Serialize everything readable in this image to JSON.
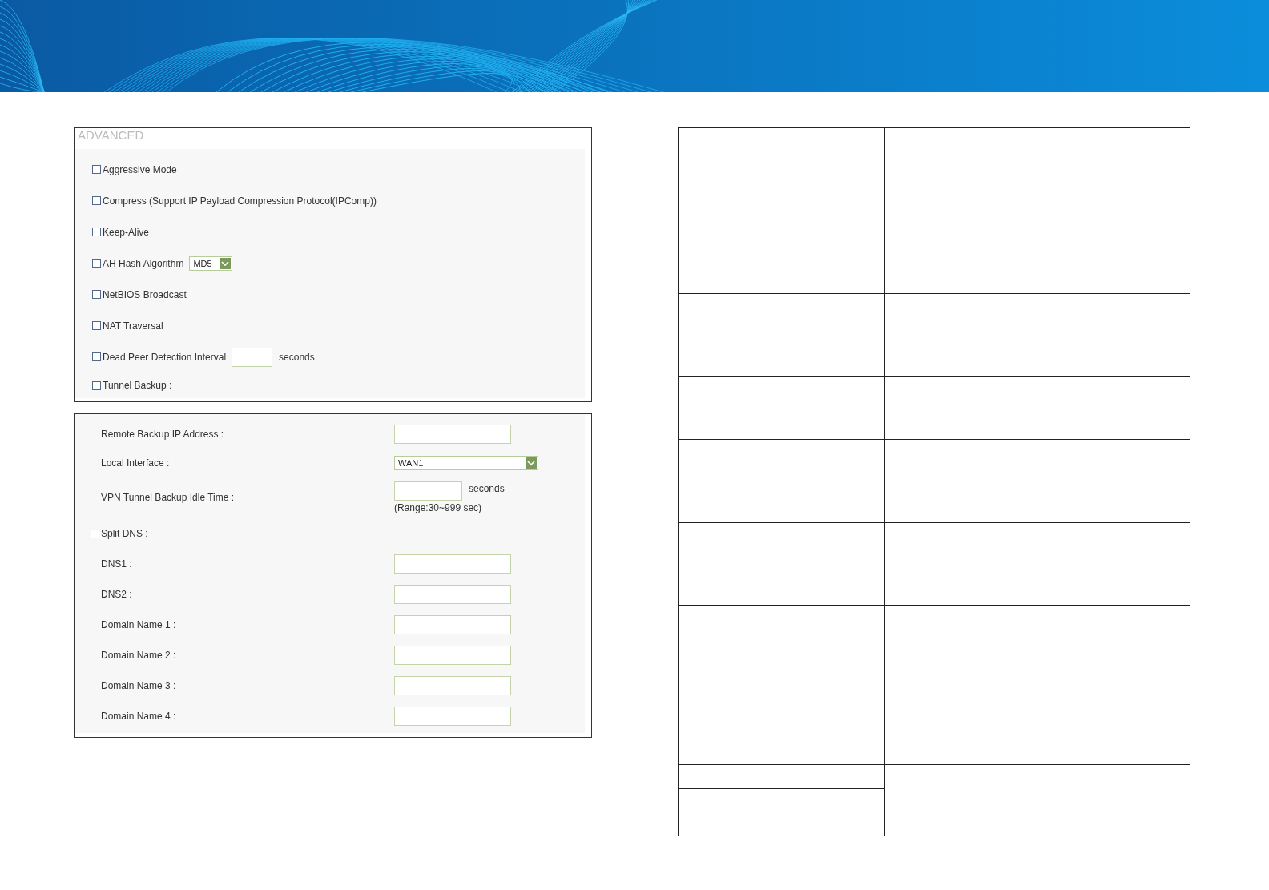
{
  "advanced": {
    "title": "ADVANCED",
    "options": [
      {
        "kind": "checkbox",
        "label": "Aggressive Mode",
        "checked": false
      },
      {
        "kind": "checkbox",
        "label": "Compress (Support IP Payload Compression Protocol(IPComp))",
        "checked": false
      },
      {
        "kind": "checkbox",
        "label": "Keep-Alive",
        "checked": false
      },
      {
        "kind": "select",
        "label": "AH Hash Algorithm",
        "checked": false,
        "value": "MD5"
      },
      {
        "kind": "checkbox",
        "label": "NetBIOS Broadcast",
        "checked": false
      },
      {
        "kind": "checkbox",
        "label": "NAT Traversal",
        "checked": false
      },
      {
        "kind": "input",
        "label": "Dead Peer Detection Interval",
        "checked": false,
        "unit": "seconds"
      },
      {
        "kind": "checkbox",
        "label": "Tunnel Backup :",
        "checked": false
      }
    ]
  },
  "backup": {
    "rows": [
      {
        "kind": "field",
        "label": "Remote Backup IP Address :"
      },
      {
        "kind": "select",
        "label": "Local Interface :",
        "value": "WAN1"
      },
      {
        "kind": "unit",
        "label": "VPN Tunnel Backup Idle Time :",
        "unit": "seconds",
        "hint": "(Range:30~999 sec)"
      },
      {
        "kind": "checkbox",
        "label": "Split DNS :",
        "checked": false
      },
      {
        "kind": "field",
        "label": "DNS1 :"
      },
      {
        "kind": "field",
        "label": "DNS2 :"
      },
      {
        "kind": "field",
        "label": "Domain Name 1 :"
      },
      {
        "kind": "field",
        "label": "Domain Name 2 :"
      },
      {
        "kind": "field",
        "label": "Domain Name 3 :"
      },
      {
        "kind": "field",
        "label": "Domain Name 4 :"
      }
    ]
  }
}
